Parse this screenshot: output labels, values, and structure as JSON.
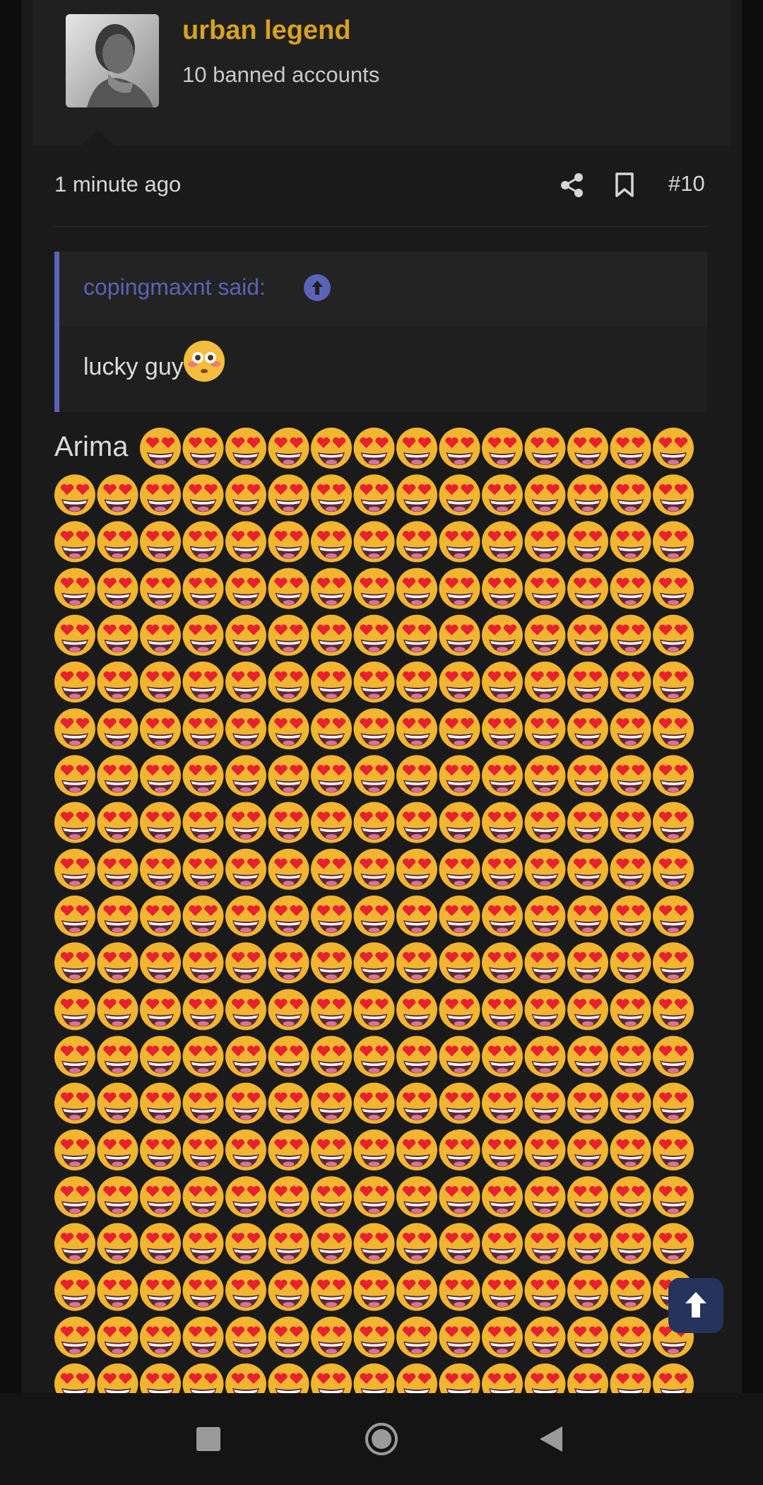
{
  "user": {
    "name": "urban legend",
    "title": "10 banned accounts"
  },
  "post": {
    "timestamp": "1 minute ago",
    "number": "#10",
    "quote": {
      "author": "copingmaxnt said:",
      "text": "lucky guy"
    },
    "body_text": "Arima",
    "emoji_name": "heart-eyes-emoji"
  },
  "colors": {
    "username": "#d8a21e",
    "quote_accent": "#5a63b5",
    "background": "#1a1a1a"
  }
}
